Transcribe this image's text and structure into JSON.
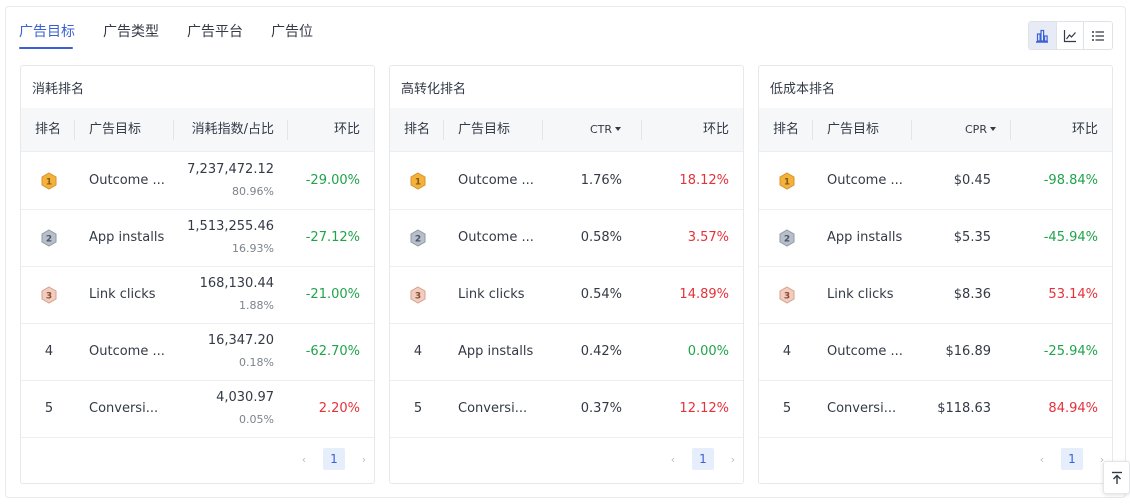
{
  "tabs": [
    "广告目标",
    "广告类型",
    "广告平台",
    "广告位"
  ],
  "active_tab": 0,
  "view_switcher": [
    "bar-chart-icon",
    "line-chart-icon",
    "list-icon"
  ],
  "colors": {
    "accent": "#3b61d5",
    "positive": "#1fa44a",
    "negative": "#e5313a",
    "gold": "#f3b23b",
    "silver": "#8e9aa6",
    "bronze": "#d9a08b"
  },
  "cards": [
    {
      "title": "消耗排名",
      "headers": {
        "rank": "排名",
        "target": "广告目标",
        "metric": "消耗指数/占比",
        "change": "环比"
      },
      "rows": [
        {
          "rank": "1",
          "name": "Outcome ...",
          "value": "7,237,472.12",
          "share": "80.96%",
          "change": "-29.00%"
        },
        {
          "rank": "2",
          "name": "App installs",
          "value": "1,513,255.46",
          "share": "16.93%",
          "change": "-27.12%"
        },
        {
          "rank": "3",
          "name": "Link clicks",
          "value": "168,130.44",
          "share": "1.88%",
          "change": "-21.00%"
        },
        {
          "rank": "4",
          "name": "Outcome ...",
          "value": "16,347.20",
          "share": "0.18%",
          "change": "-62.70%"
        },
        {
          "rank": "5",
          "name": "Conversi...",
          "value": "4,030.97",
          "share": "0.05%",
          "change": "2.20%"
        }
      ],
      "page": "1"
    },
    {
      "title": "高转化排名",
      "headers": {
        "rank": "排名",
        "target": "广告目标",
        "metric": "CTR",
        "change": "环比"
      },
      "rows": [
        {
          "rank": "1",
          "name": "Outcome ...",
          "value": "1.76%",
          "change": "18.12%"
        },
        {
          "rank": "2",
          "name": "Outcome ...",
          "value": "0.58%",
          "change": "3.57%"
        },
        {
          "rank": "3",
          "name": "Link clicks",
          "value": "0.54%",
          "change": "14.89%"
        },
        {
          "rank": "4",
          "name": "App installs",
          "value": "0.42%",
          "change": "0.00%"
        },
        {
          "rank": "5",
          "name": "Conversi...",
          "value": "0.37%",
          "change": "12.12%"
        }
      ],
      "page": "1"
    },
    {
      "title": "低成本排名",
      "headers": {
        "rank": "排名",
        "target": "广告目标",
        "metric": "CPR",
        "change": "环比"
      },
      "rows": [
        {
          "rank": "1",
          "name": "Outcome ...",
          "value": "$0.45",
          "change": "-98.84%"
        },
        {
          "rank": "2",
          "name": "App installs",
          "value": "$5.35",
          "change": "-45.94%"
        },
        {
          "rank": "3",
          "name": "Link clicks",
          "value": "$8.36",
          "change": "53.14%"
        },
        {
          "rank": "4",
          "name": "Outcome ...",
          "value": "$16.89",
          "change": "-25.94%"
        },
        {
          "rank": "5",
          "name": "Conversi...",
          "value": "$118.63",
          "change": "84.94%"
        }
      ],
      "page": "1"
    }
  ],
  "icons": {
    "medal_1": "gold-medal-icon",
    "medal_2": "silver-medal-icon",
    "medal_3": "bronze-medal-icon",
    "back_to_top": "back-to-top-icon"
  }
}
